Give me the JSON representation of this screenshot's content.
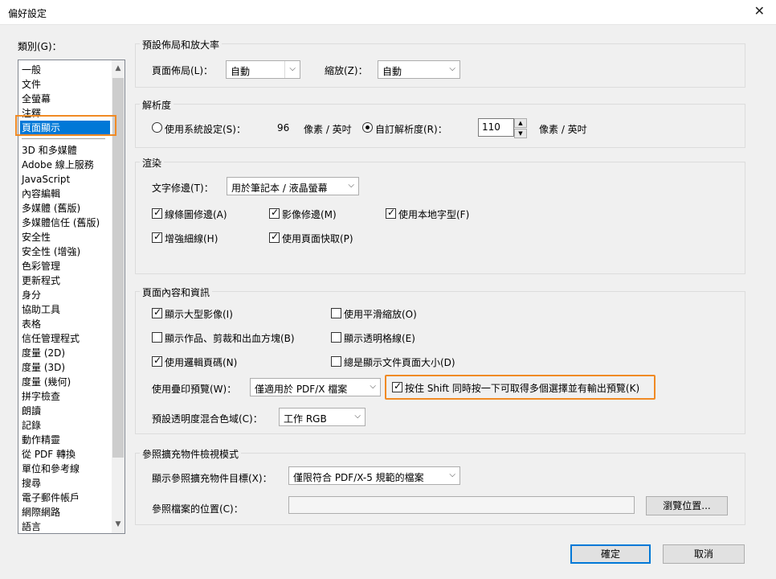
{
  "window": {
    "title": "偏好設定",
    "close_icon": "close-icon"
  },
  "categories": {
    "label": "類別(G)：",
    "items_top": [
      "一般",
      "文件",
      "全螢幕",
      "注釋",
      "頁面顯示"
    ],
    "items_bottom": [
      "3D 和多媒體",
      "Adobe 線上服務",
      "JavaScript",
      "內容編輯",
      "多媒體 (舊版)",
      "多媒體信任 (舊版)",
      "安全性",
      "安全性 (增強)",
      "色彩管理",
      "更新程式",
      "身分",
      "協助工具",
      "表格",
      "信任管理程式",
      "度量 (2D)",
      "度量 (3D)",
      "度量 (幾何)",
      "拼字檢查",
      "朗讀",
      "記錄",
      "動作精靈",
      "從 PDF 轉換",
      "單位和參考線",
      "搜尋",
      "電子郵件帳戶",
      "網際網路",
      "語言"
    ],
    "selected": "頁面顯示"
  },
  "layout_zoom": {
    "title": "預設佈局和放大率",
    "page_layout_label": "頁面佈局(L)：",
    "page_layout_value": "自動",
    "zoom_label": "縮放(Z)：",
    "zoom_value": "自動"
  },
  "resolution": {
    "title": "解析度",
    "system_label": "使用系統設定(S)：",
    "system_value": "96",
    "system_unit": "像素 / 英吋",
    "custom_label": "自訂解析度(R)：",
    "custom_value": "110",
    "custom_unit": "像素 / 英吋",
    "selected": "custom"
  },
  "rendering": {
    "title": "渲染",
    "smooth_text_label": "文字修邊(T)：",
    "smooth_text_value": "用於筆記本 / 液晶螢幕",
    "line_art": {
      "label": "線條圖修邊(A)",
      "checked": true
    },
    "images": {
      "label": "影像修邊(M)",
      "checked": true
    },
    "local_fonts": {
      "label": "使用本地字型(F)",
      "checked": true
    },
    "enhance_thin": {
      "label": "增強細線(H)",
      "checked": true
    },
    "page_cache": {
      "label": "使用頁面快取(P)",
      "checked": true
    }
  },
  "page_content": {
    "title": "頁面內容和資訊",
    "large_images": {
      "label": "顯示大型影像(I)",
      "checked": true
    },
    "smooth_zoom": {
      "label": "使用平滑縮放(O)",
      "checked": false
    },
    "art_trim": {
      "label": "顯示作品、剪裁和出血方塊(B)",
      "checked": false
    },
    "transparency_grid": {
      "label": "顯示透明格線(E)",
      "checked": false
    },
    "logical_page": {
      "label": "使用邏輯頁碼(N)",
      "checked": true
    },
    "doc_page_size": {
      "label": "總是顯示文件頁面大小(D)",
      "checked": false
    },
    "overprint_label": "使用疊印預覽(W)：",
    "overprint_value": "僅適用於 PDF/X 檔案",
    "shift_click": {
      "label": "按住 Shift 同時按一下可取得多個選擇並有輸出預覽(K)",
      "checked": true
    },
    "blend_label": "預設透明度混合色域(C)：",
    "blend_value": "工作 RGB"
  },
  "xobject": {
    "title": "參照擴充物件檢視模式",
    "show_label": "顯示參照擴充物件目標(X)：",
    "show_value": "僅限符合 PDF/X-5 規範的檔案",
    "location_label": "參照檔案的位置(C)：",
    "location_value": "",
    "browse_label": "瀏覽位置..."
  },
  "footer": {
    "ok_label": "確定",
    "cancel_label": "取消"
  },
  "colors": {
    "highlight": "#f08a24",
    "selection": "#0078d7"
  }
}
